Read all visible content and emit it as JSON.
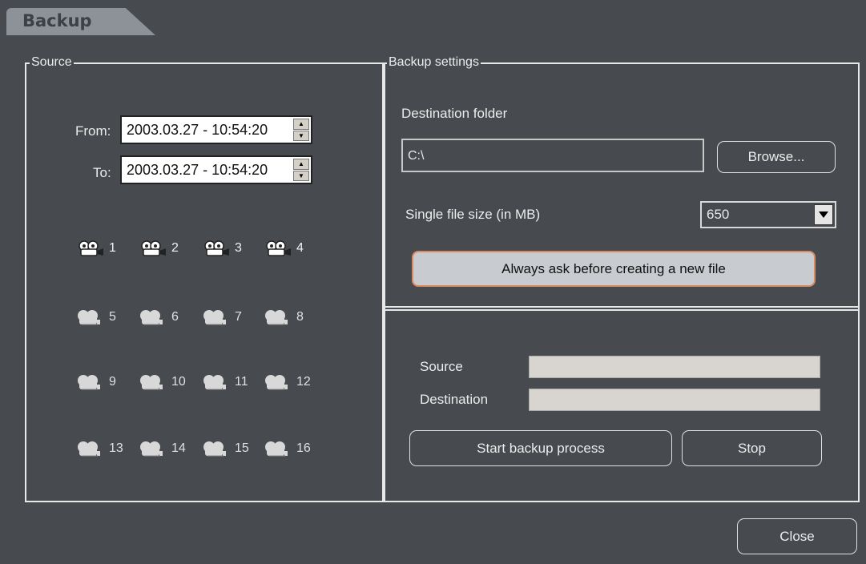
{
  "window": {
    "title": "Backup"
  },
  "source": {
    "legend": "Source",
    "from_label": "From:",
    "from_value": "2003.03.27 - 10:54:20",
    "to_label": "To:",
    "to_value": "2003.03.27 - 10:54:20",
    "cameras": [
      "1",
      "2",
      "3",
      "4",
      "5",
      "6",
      "7",
      "8",
      "9",
      "10",
      "11",
      "12",
      "13",
      "14",
      "15",
      "16"
    ]
  },
  "settings": {
    "legend": "Backup settings",
    "dest_label": "Destination folder",
    "dest_value": "C:\\",
    "browse_label": "Browse...",
    "size_label": "Single file size (in MB)",
    "size_value": "650",
    "ask_label": "Always ask before creating a new file"
  },
  "progress": {
    "source_label": "Source",
    "destination_label": "Destination",
    "start_label": "Start backup process",
    "stop_label": "Stop"
  },
  "footer": {
    "close_label": "Close"
  }
}
